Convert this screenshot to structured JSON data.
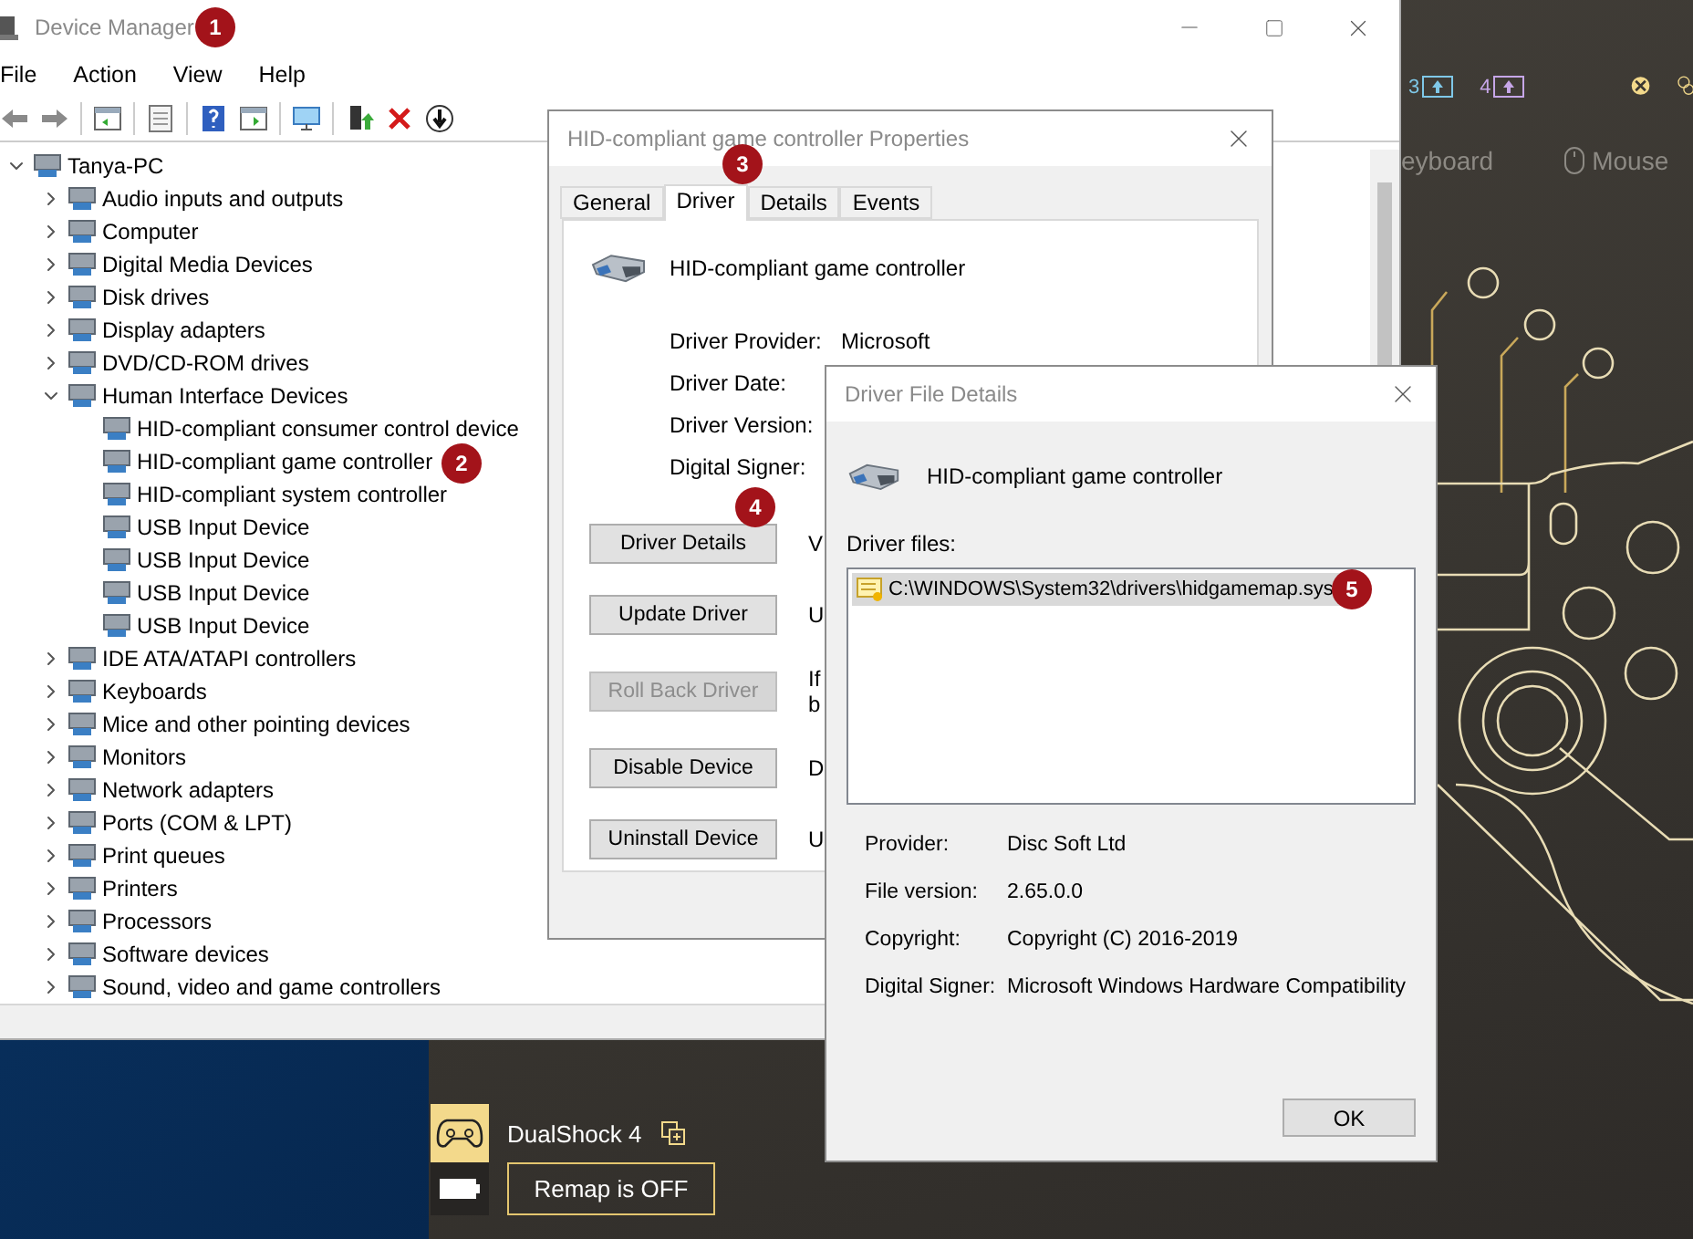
{
  "device_manager": {
    "title": "Device Manager",
    "menu": [
      "File",
      "Action",
      "View",
      "Help"
    ],
    "tree": {
      "label": "Tanya-PC",
      "expanded": true,
      "children": [
        {
          "label": "Audio inputs and outputs",
          "expanded": false
        },
        {
          "label": "Computer",
          "expanded": false
        },
        {
          "label": "Digital Media Devices",
          "expanded": false
        },
        {
          "label": "Disk drives",
          "expanded": false
        },
        {
          "label": "Display adapters",
          "expanded": false
        },
        {
          "label": "DVD/CD-ROM drives",
          "expanded": false
        },
        {
          "label": "Human Interface Devices",
          "expanded": true,
          "children": [
            {
              "label": "HID-compliant consumer control device"
            },
            {
              "label": "HID-compliant game controller"
            },
            {
              "label": "HID-compliant system controller"
            },
            {
              "label": "USB Input Device"
            },
            {
              "label": "USB Input Device"
            },
            {
              "label": "USB Input Device"
            },
            {
              "label": "USB Input Device"
            }
          ]
        },
        {
          "label": "IDE ATA/ATAPI controllers",
          "expanded": false
        },
        {
          "label": "Keyboards",
          "expanded": false
        },
        {
          "label": "Mice and other pointing devices",
          "expanded": false
        },
        {
          "label": "Monitors",
          "expanded": false
        },
        {
          "label": "Network adapters",
          "expanded": false
        },
        {
          "label": "Ports (COM & LPT)",
          "expanded": false
        },
        {
          "label": "Print queues",
          "expanded": false
        },
        {
          "label": "Printers",
          "expanded": false
        },
        {
          "label": "Processors",
          "expanded": false
        },
        {
          "label": "Software devices",
          "expanded": false
        },
        {
          "label": "Sound, video and game controllers",
          "expanded": false
        }
      ]
    }
  },
  "properties_dialog": {
    "title": "HID-compliant game controller Properties",
    "tabs": [
      {
        "label": "General",
        "selected": false
      },
      {
        "label": "Driver",
        "selected": true
      },
      {
        "label": "Details",
        "selected": false
      },
      {
        "label": "Events",
        "selected": false
      }
    ],
    "device_name": "HID-compliant game controller",
    "fields": [
      {
        "label": "Driver Provider:",
        "value": "Microsoft"
      },
      {
        "label": "Driver Date:"
      },
      {
        "label": "Driver Version:"
      },
      {
        "label": "Digital Signer:"
      }
    ],
    "actions": [
      {
        "label": "Driver Details",
        "disabled": false,
        "description": [
          "V"
        ]
      },
      {
        "label": "Update Driver",
        "disabled": false,
        "description": [
          "U"
        ]
      },
      {
        "label": "Roll Back Driver",
        "disabled": true,
        "description": [
          "If",
          "b"
        ]
      },
      {
        "label": "Disable Device",
        "disabled": false,
        "description": [
          "D"
        ]
      },
      {
        "label": "Uninstall Device",
        "disabled": false,
        "description": [
          "U"
        ]
      }
    ]
  },
  "file_details_dialog": {
    "title": "Driver File Details",
    "device_name": "HID-compliant game controller",
    "files_label": "Driver files:",
    "files": [
      {
        "path": "C:\\WINDOWS\\System32\\drivers\\hidgamemap.sys",
        "selected": true
      }
    ],
    "info": [
      {
        "label": "Provider:",
        "value": "Disc Soft Ltd"
      },
      {
        "label": "File version:",
        "value": "2.65.0.0"
      },
      {
        "label": "Copyright:",
        "value": "Copyright (C) 2016-2019"
      },
      {
        "label": "Digital Signer:",
        "value": "Microsoft Windows Hardware Compatibility"
      }
    ],
    "ok_button": "OK"
  },
  "remap_app": {
    "display_buttons": [
      "3",
      "4"
    ],
    "input_tabs": [
      "eyboard",
      "Mouse"
    ],
    "device": {
      "name": "DualShock 4",
      "remap_button": "Remap is OFF"
    }
  },
  "annotations": [
    "1",
    "2",
    "3",
    "4",
    "5"
  ]
}
